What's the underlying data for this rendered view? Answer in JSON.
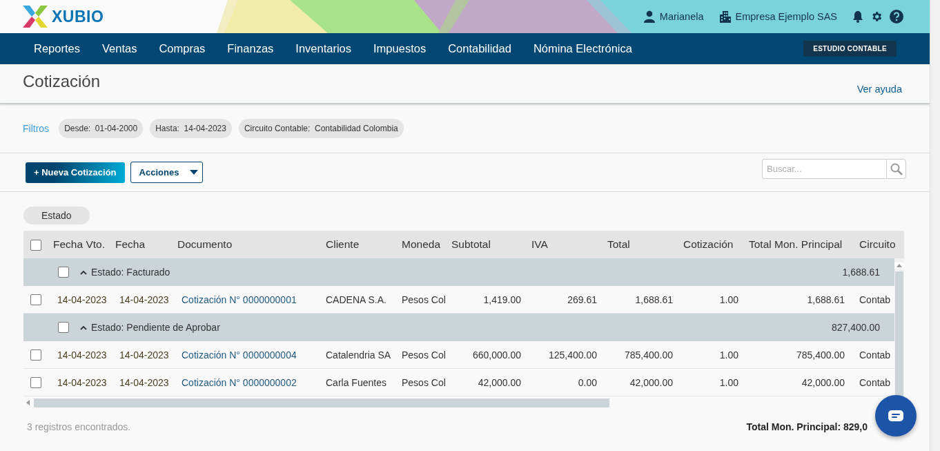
{
  "header": {
    "brand": "XUBIO",
    "user": "Marianela",
    "company": "Empresa Ejemplo SAS"
  },
  "nav": {
    "items": [
      "Reportes",
      "Ventas",
      "Compras",
      "Finanzas",
      "Inventarios",
      "Impuestos",
      "Contabilidad",
      "Nómina Electrónica"
    ],
    "badge": "ESTUDIO CONTABLE"
  },
  "page": {
    "title": "Cotización",
    "help_link": "Ver ayuda"
  },
  "filters": {
    "label": "Filtros",
    "chips": [
      "Desde:  01-04-2000",
      "Hasta:  14-04-2023",
      "Circuito Contable:  Contabilidad Colombia"
    ]
  },
  "toolbar": {
    "primary_button": "+ Nueva Cotización",
    "actions_button": "Acciones",
    "search": {
      "placeholder": "Buscar..."
    }
  },
  "grouping_chip": "Estado",
  "table": {
    "header_checked": false,
    "columns": [
      {
        "label": "Fecha Vto.",
        "kind": "date"
      },
      {
        "label": "Fecha",
        "kind": "date"
      },
      {
        "label": "Documento",
        "kind": "link"
      },
      {
        "label": "Cliente",
        "kind": "text"
      },
      {
        "label": "Moneda",
        "kind": "text"
      },
      {
        "label": "Subtotal",
        "kind": "number"
      },
      {
        "label": "IVA",
        "kind": "number"
      },
      {
        "label": "Total",
        "kind": "number"
      },
      {
        "label": "Cotización",
        "kind": "number"
      },
      {
        "label": "Total Mon. Principal",
        "kind": "number"
      },
      {
        "label": "Circuito",
        "kind": "text"
      }
    ],
    "groups": [
      {
        "label": "Estado: Facturado",
        "expanded": true,
        "checked": false,
        "total": "1,688.61",
        "rows": [
          {
            "checked": false,
            "cells": [
              "14-04-2023",
              "14-04-2023",
              "Cotización N° 0000000001",
              "CADENA S.A.",
              "Pesos Col",
              "1,419.00",
              "269.61",
              "1,688.61",
              "1.00",
              "1,688.61",
              "Contab"
            ]
          }
        ]
      },
      {
        "label": "Estado: Pendiente de Aprobar",
        "expanded": true,
        "checked": false,
        "total": "827,400.00",
        "rows": [
          {
            "checked": false,
            "cells": [
              "14-04-2023",
              "14-04-2023",
              "Cotización N° 0000000004",
              "Catalendria SA",
              "Pesos Col",
              "660,000.00",
              "125,400.00",
              "785,400.00",
              "1.00",
              "785,400.00",
              "Contab"
            ]
          },
          {
            "checked": false,
            "cells": [
              "14-04-2023",
              "14-04-2023",
              "Cotización N° 0000000002",
              "Carla Fuentes",
              "Pesos Col",
              "42,000.00",
              "0.00",
              "42,000.00",
              "1.00",
              "42,000.00",
              "Contab"
            ]
          }
        ]
      }
    ]
  },
  "footer": {
    "count": "3 registros encontrados.",
    "total": "Total Mon. Principal: 829,0"
  }
}
